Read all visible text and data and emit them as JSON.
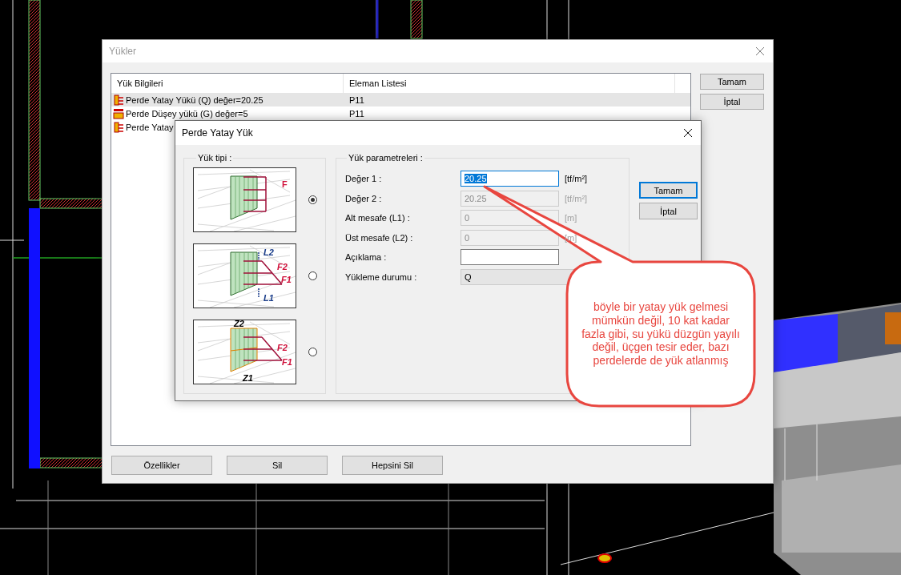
{
  "loads_dialog": {
    "title": "Yükler",
    "columns": [
      "Yük Bilgileri",
      "Eleman Listesi"
    ],
    "rows": [
      {
        "kind": "horizontal",
        "info": "Perde Yatay Yükü (Q) değer=20.25",
        "elements": "P11",
        "selected": true
      },
      {
        "kind": "vertical",
        "info": "Perde Düşey yükü (G) değer=5",
        "elements": "P11",
        "selected": false
      },
      {
        "kind": "horizontal",
        "info": "Perde Yatay",
        "elements": "",
        "selected": false
      }
    ],
    "side_buttons": [
      "Tamam",
      "İptal"
    ],
    "bottom_buttons": [
      "Özellikler",
      "Sil",
      "Hepsini Sil"
    ]
  },
  "wall_load_dialog": {
    "title": "Perde Yatay Yük",
    "type_group": {
      "title": "Yük tipi :",
      "options": [
        {
          "kind": "uniform",
          "labels": [
            "F"
          ],
          "selected": true
        },
        {
          "kind": "trapezoid",
          "labels": [
            "L2",
            "F2",
            "F1",
            "L1"
          ],
          "selected": false
        },
        {
          "kind": "zoned",
          "labels": [
            "Z2",
            "F2",
            "F1",
            "Z1"
          ],
          "selected": false
        }
      ]
    },
    "param_group": {
      "title": "Yük parametreleri :",
      "fields": [
        {
          "kind": "input",
          "label": "Değer 1 :",
          "value": "20.25",
          "unit": "[tf/m²]",
          "disabled": false,
          "selected": true
        },
        {
          "kind": "input",
          "label": "Değer 2 :",
          "value": "20.25",
          "unit": "[tf/m²]",
          "disabled": true,
          "selected": false
        },
        {
          "kind": "input",
          "label": "Alt mesafe (L1) :",
          "value": "0",
          "unit": "[m]",
          "disabled": true,
          "selected": false
        },
        {
          "kind": "input",
          "label": "Üst mesafe (L2) :",
          "value": "0",
          "unit": "[m]",
          "disabled": true,
          "selected": false
        },
        {
          "kind": "input",
          "label": "Açıklama :",
          "disabled": false,
          "selected": false
        },
        {
          "kind": "combo",
          "label": "Yükleme durumu :",
          "value": "Q",
          "disabled": true,
          "selected": false
        }
      ]
    },
    "buttons": [
      {
        "label": "Tamam",
        "focused": true
      },
      {
        "label": "İptal",
        "focused": false
      }
    ]
  },
  "callout": {
    "text": "böyle bir yatay yük gelmesi mümkün değil, 10 kat kadar fazla gibi, su yükü düzgün yayılı değil, üçgen tesir eder, bazı perdelerde de yük atlanmış"
  }
}
